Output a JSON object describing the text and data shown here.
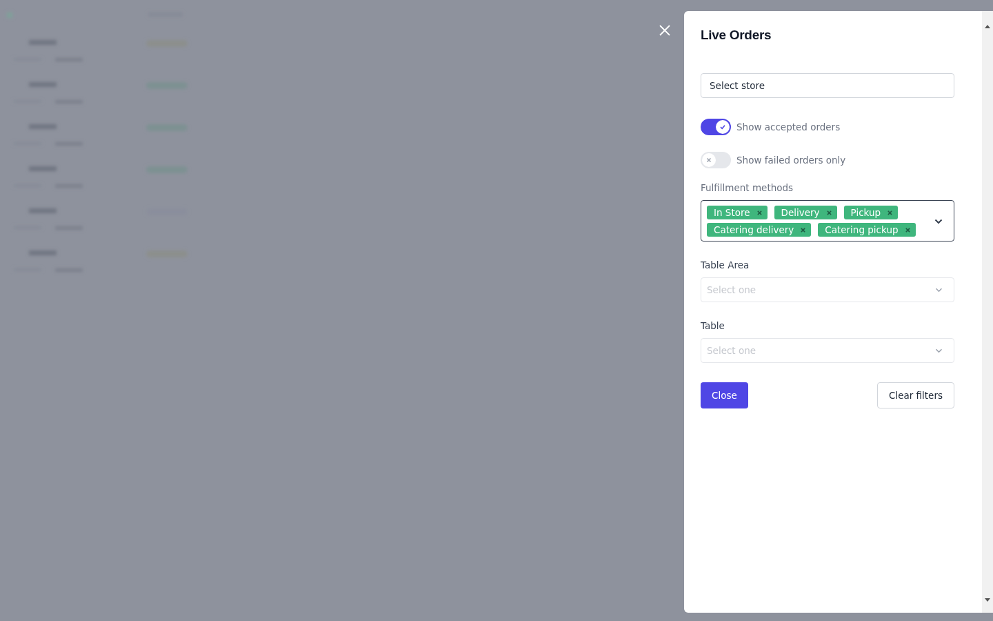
{
  "panel": {
    "title": "Live Orders",
    "store_select": {
      "value": "Select store"
    },
    "toggles": [
      {
        "label": "Show accepted orders",
        "on": true
      },
      {
        "label": "Show failed orders only",
        "on": false
      }
    ],
    "fulfillment": {
      "label": "Fulfillment methods",
      "tags": [
        "In Store",
        "Delivery",
        "Pickup",
        "Catering delivery",
        "Catering pickup"
      ]
    },
    "selects": [
      {
        "label": "Table Area",
        "placeholder": "Select one"
      },
      {
        "label": "Table",
        "placeholder": "Select one"
      }
    ],
    "buttons": [
      {
        "label": "Close",
        "kind": "primary"
      },
      {
        "label": "Clear filters",
        "kind": "secondary"
      }
    ]
  }
}
